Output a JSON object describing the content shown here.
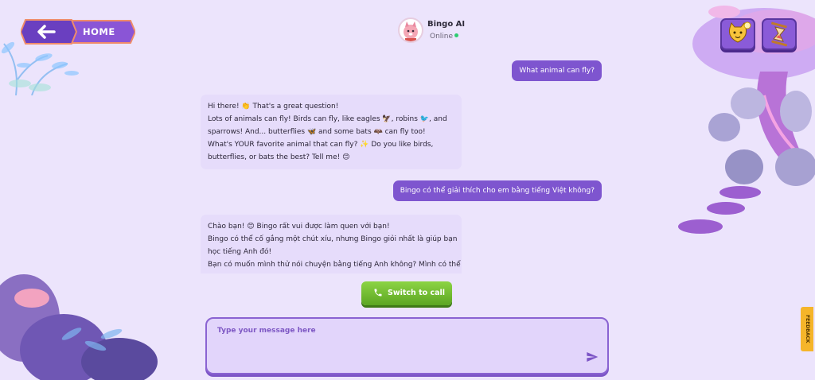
{
  "nav": {
    "home_label": "HOME"
  },
  "bot": {
    "name": "Bingo AI",
    "status": "Online"
  },
  "messages": {
    "user1": "What animal can fly?",
    "bot1": [
      "Hi there! 👏 That's a great question!",
      "Lots of animals can fly! Birds can fly, like eagles 🦅, robins 🐦, and",
      "sparrows! And... butterflies 🦋 and some bats 🦇 can fly too!",
      "What's YOUR favorite animal that can fly? ✨ Do you like birds,",
      "butterflies, or bats the best? Tell me! 😊"
    ],
    "user2": "Bingo có thể giải thích cho em bằng tiếng Việt không?",
    "bot2": [
      "Chào bạn! 😊 Bingo rất vui được làm quen với bạn!",
      "Bingo có thể cố gắng một chút xíu, nhưng Bingo giỏi nhất là giúp bạn",
      "học tiếng Anh đó!",
      "Bạn có muốn mình thử nói chuyện bằng tiếng Anh không? Mình có thể"
    ]
  },
  "call_button": {
    "label": "Switch to call"
  },
  "composer": {
    "placeholder": "Type your message here"
  },
  "feedback": {
    "label": "FEEDBACK"
  },
  "icons": {
    "back": "arrow-left-icon",
    "send": "send-icon",
    "phone": "phone-icon",
    "mascot": "cat-face-icon",
    "hourglass": "hourglass-icon"
  },
  "colors": {
    "background": "#ece4fc",
    "accent": "#7e55cf",
    "call_green": "#6cb82f",
    "bot_bubble": "#e6dcfb"
  }
}
